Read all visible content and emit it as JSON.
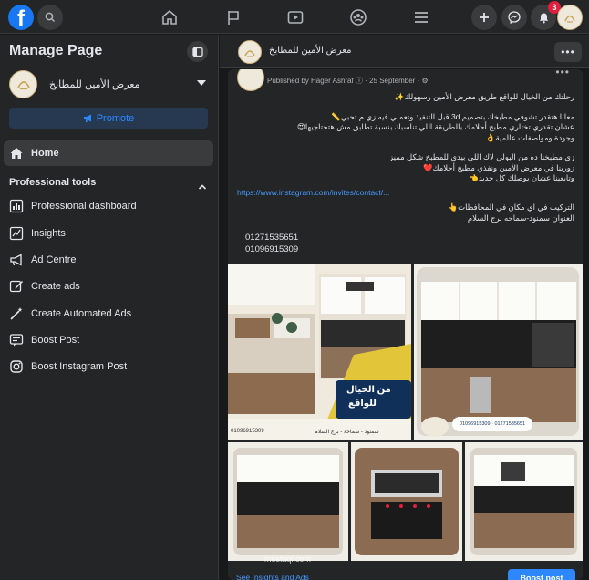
{
  "topbar": {
    "logo_letter": "f",
    "notification_count": "3"
  },
  "sidebar": {
    "title": "Manage Page",
    "page_name": "معرض الأمين للمطابخ",
    "promote_label": "Promote",
    "home_label": "Home",
    "section_title": "Professional tools",
    "tools": [
      {
        "label": "Professional dashboard",
        "icon": "dashboard-icon"
      },
      {
        "label": "Insights",
        "icon": "insights-icon"
      },
      {
        "label": "Ad Centre",
        "icon": "megaphone-icon"
      },
      {
        "label": "Create ads",
        "icon": "pencil-icon"
      },
      {
        "label": "Create Automated Ads",
        "icon": "magic-wand-icon"
      },
      {
        "label": "Boost Post",
        "icon": "boost-post-icon"
      },
      {
        "label": "Boost Instagram Post",
        "icon": "instagram-icon"
      }
    ]
  },
  "header": {
    "page_name": "معرض الأمين للمطابخ",
    "more_label": "•••"
  },
  "post": {
    "published_by": "Published by Hager Ashraf",
    "date": "25 September",
    "more_label": "•••",
    "line1": "رحلتك من الخيال للواقع طريق معرض الأمين رسهولك✨",
    "line2": "معانا هتقدر تشوفي مطبخك بتصميم 3d قبل التنفيذ وتعملي فيه زي م تحبي📏",
    "line3": "عشان تقدري تختاري مطبخ أحلامك بالطريقة اللي تناسبك بنسبة تطابق مش هتحتاجيها😍",
    "line4": "وجودة ومواصفات عالمية👌",
    "line5": "زي مطبخنا ده من البولي لاك اللي بيدي للمطبخ شكل مميز",
    "line6": "زورينا في معرض الأمين ونفذي مطبخ أحلامك❤️",
    "line7": "وتابعينا عشان يوصلك كل جديد👈",
    "link": "https://www.instagram.com/invites/contact/...",
    "line8": "التركيب في اي مكان في المحافظات👆",
    "line9": "العنوان سمنود-سماحه برج السلام",
    "phone1": "01271535651",
    "phone2": "01096915309",
    "promo_text1": "من الخيال",
    "promo_text2": "للواقع",
    "promo_phone": "01096915309 · 01271535651",
    "promo_address": "سمنود - سماحة - برج السلام",
    "footer_link": "See Insights and Ads",
    "boost_label": "Boost post"
  },
  "watermark": "mostaql.com",
  "colors": {
    "background": "#18191a",
    "surface": "#242526",
    "accent": "#2d88ff",
    "fb_blue": "#1877f2",
    "badge": "#e41e3f",
    "promo_gold": "#e3c53a",
    "promo_blue": "#10305a"
  }
}
